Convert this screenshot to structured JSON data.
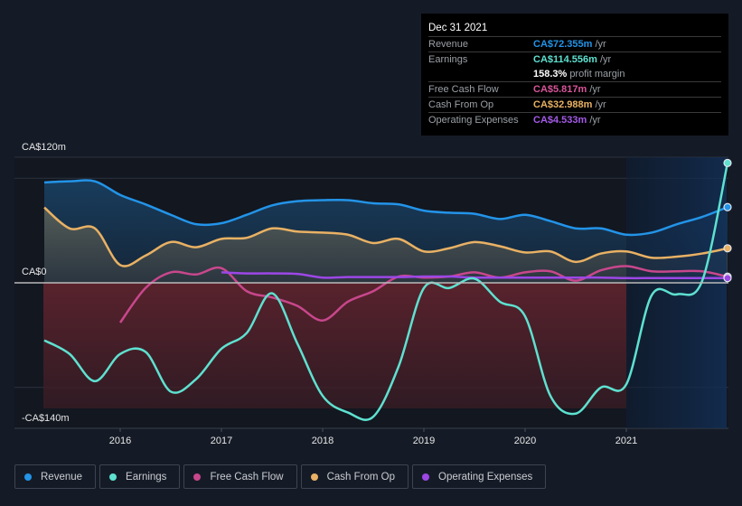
{
  "tooltip": {
    "date": "Dec 31 2021",
    "rows": [
      {
        "label": "Revenue",
        "value": "CA$72.355m",
        "unit": "/yr",
        "color": "#2394e8"
      },
      {
        "label": "Earnings",
        "value": "CA$114.556m",
        "unit": "/yr",
        "color": "#5ee1d0"
      },
      {
        "label": "",
        "value": "158.3%",
        "unit": "profit margin",
        "color": "#ffffff"
      },
      {
        "label": "Free Cash Flow",
        "value": "CA$5.817m",
        "unit": "/yr",
        "color": "#d9559a"
      },
      {
        "label": "Cash From Op",
        "value": "CA$32.988m",
        "unit": "/yr",
        "color": "#e9b164"
      },
      {
        "label": "Operating Expenses",
        "value": "CA$4.533m",
        "unit": "/yr",
        "color": "#a45ae8"
      }
    ]
  },
  "legend": [
    {
      "label": "Revenue",
      "color": "#2394e8"
    },
    {
      "label": "Earnings",
      "color": "#5ee1d0"
    },
    {
      "label": "Free Cash Flow",
      "color": "#c8478c"
    },
    {
      "label": "Cash From Op",
      "color": "#e9b164"
    },
    {
      "label": "Operating Expenses",
      "color": "#9c47e6"
    }
  ],
  "chart_data": {
    "type": "line",
    "title": "",
    "xlabel": "",
    "ylabel": "",
    "y_tick_labels": [
      "CA$120m",
      "CA$0",
      "-CA$140m"
    ],
    "y_ticks": [
      120,
      0,
      -140
    ],
    "ylim": [
      -140,
      120
    ],
    "x_tick_labels": [
      "2016",
      "2017",
      "2018",
      "2019",
      "2020",
      "2021"
    ],
    "x_ticks": [
      2016,
      2017,
      2018,
      2019,
      2020,
      2021
    ],
    "xlim": [
      2015.25,
      2022.0
    ],
    "grid": true,
    "legend_position": "bottom",
    "highlight_region": [
      2021.0,
      2022.0
    ],
    "series": [
      {
        "name": "Revenue",
        "color": "#2394e8",
        "x": [
          2015.25,
          2015.5,
          2015.75,
          2016.0,
          2016.25,
          2016.5,
          2016.75,
          2017.0,
          2017.25,
          2017.5,
          2017.75,
          2018.0,
          2018.25,
          2018.5,
          2018.75,
          2019.0,
          2019.25,
          2019.5,
          2019.75,
          2020.0,
          2020.25,
          2020.5,
          2020.75,
          2021.0,
          2021.25,
          2021.5,
          2021.75,
          2022.0
        ],
        "values": [
          96,
          97,
          97,
          84,
          75,
          65,
          56,
          57,
          65,
          74,
          78,
          79,
          79,
          76,
          75,
          69,
          67,
          66,
          61,
          65,
          59,
          52,
          52,
          46,
          48,
          56,
          63,
          72.355
        ]
      },
      {
        "name": "Earnings",
        "color": "#5ee1d0",
        "x": [
          2015.25,
          2015.5,
          2015.75,
          2016.0,
          2016.25,
          2016.5,
          2016.75,
          2017.0,
          2017.25,
          2017.5,
          2017.75,
          2018.0,
          2018.25,
          2018.5,
          2018.75,
          2019.0,
          2019.25,
          2019.5,
          2019.75,
          2020.0,
          2020.25,
          2020.5,
          2020.75,
          2021.0,
          2021.25,
          2021.5,
          2021.75,
          2022.0
        ],
        "values": [
          -55,
          -68,
          -94,
          -68,
          -66,
          -104,
          -92,
          -63,
          -48,
          -10,
          -58,
          -108,
          -124,
          -128,
          -80,
          -5,
          -5,
          4,
          -18,
          -32,
          -108,
          -125,
          -100,
          -97,
          -12,
          -11,
          2,
          114.556
        ]
      },
      {
        "name": "Free Cash Flow",
        "color": "#c8478c",
        "x": [
          2016.0,
          2016.25,
          2016.5,
          2016.75,
          2017.0,
          2017.25,
          2017.5,
          2017.75,
          2018.0,
          2018.25,
          2018.5,
          2018.75,
          2019.0,
          2019.25,
          2019.5,
          2019.75,
          2020.0,
          2020.25,
          2020.5,
          2020.75,
          2021.0,
          2021.25,
          2021.5,
          2021.75,
          2022.0
        ],
        "values": [
          -38,
          -5,
          10,
          8,
          14,
          -8,
          -14,
          -22,
          -36,
          -18,
          -8,
          6,
          5,
          6,
          10,
          5,
          10,
          11,
          2,
          12,
          16,
          11,
          11,
          11,
          5.817
        ]
      },
      {
        "name": "Cash From Op",
        "color": "#e9b164",
        "x": [
          2015.25,
          2015.5,
          2015.75,
          2016.0,
          2016.25,
          2016.5,
          2016.75,
          2017.0,
          2017.25,
          2017.5,
          2017.75,
          2018.0,
          2018.25,
          2018.5,
          2018.75,
          2019.0,
          2019.25,
          2019.5,
          2019.75,
          2020.0,
          2020.25,
          2020.5,
          2020.75,
          2021.0,
          2021.25,
          2021.5,
          2021.75,
          2022.0
        ],
        "values": [
          72,
          52,
          52,
          17,
          26,
          39,
          34,
          42,
          43,
          52,
          49,
          48,
          46,
          38,
          42,
          30,
          33,
          39,
          35,
          29,
          30,
          20,
          28,
          30,
          24,
          25,
          28,
          32.988
        ]
      },
      {
        "name": "Operating Expenses",
        "color": "#9c47e6",
        "x": [
          2017.0,
          2017.25,
          2017.5,
          2017.75,
          2018.0,
          2018.25,
          2018.5,
          2018.75,
          2019.0,
          2019.25,
          2019.5,
          2019.75,
          2020.0,
          2020.25,
          2020.5,
          2020.75,
          2021.0,
          2021.25,
          2021.5,
          2021.75,
          2022.0
        ],
        "values": [
          10,
          9,
          9,
          8.5,
          5,
          5.5,
          5.5,
          5.5,
          6,
          6,
          5,
          5,
          5,
          5,
          5,
          5,
          4.5,
          4.5,
          4.5,
          4.5,
          4.533
        ]
      }
    ]
  }
}
